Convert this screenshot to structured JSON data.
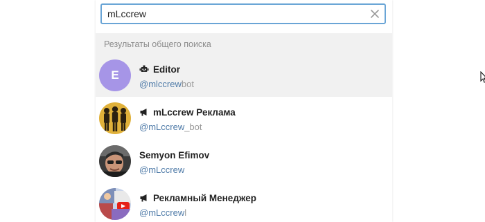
{
  "search": {
    "value": "mLccrew",
    "clear_icon": "close-icon"
  },
  "section": {
    "title": "Результаты общего поиска"
  },
  "results": [
    {
      "name": "Editor",
      "kind_icon": "bot-icon",
      "avatar_letter": "E",
      "avatar_color": "#a695e7",
      "username_match": "@mlccrew",
      "username_rest": "bot"
    },
    {
      "name": "mLccrew Реклама",
      "kind_icon": "megaphone-icon",
      "avatar_icon": "people-silhouettes-avatar",
      "username_match": "@mLccrew",
      "username_rest": "_bot"
    },
    {
      "name": "Semyon Efimov",
      "avatar_icon": "person-photo-avatar",
      "username_match": "@mLccrew",
      "username_rest": ""
    },
    {
      "name": "Рекламный Менеджер",
      "kind_icon": "megaphone-icon",
      "avatar_icon": "youtube-collage-avatar",
      "username_match": "@mLccrew",
      "username_rest": "l"
    }
  ],
  "colors": {
    "accent": "#6aa5d6",
    "link": "#4f7ba8",
    "selected_bg": "#f1f1f1"
  }
}
